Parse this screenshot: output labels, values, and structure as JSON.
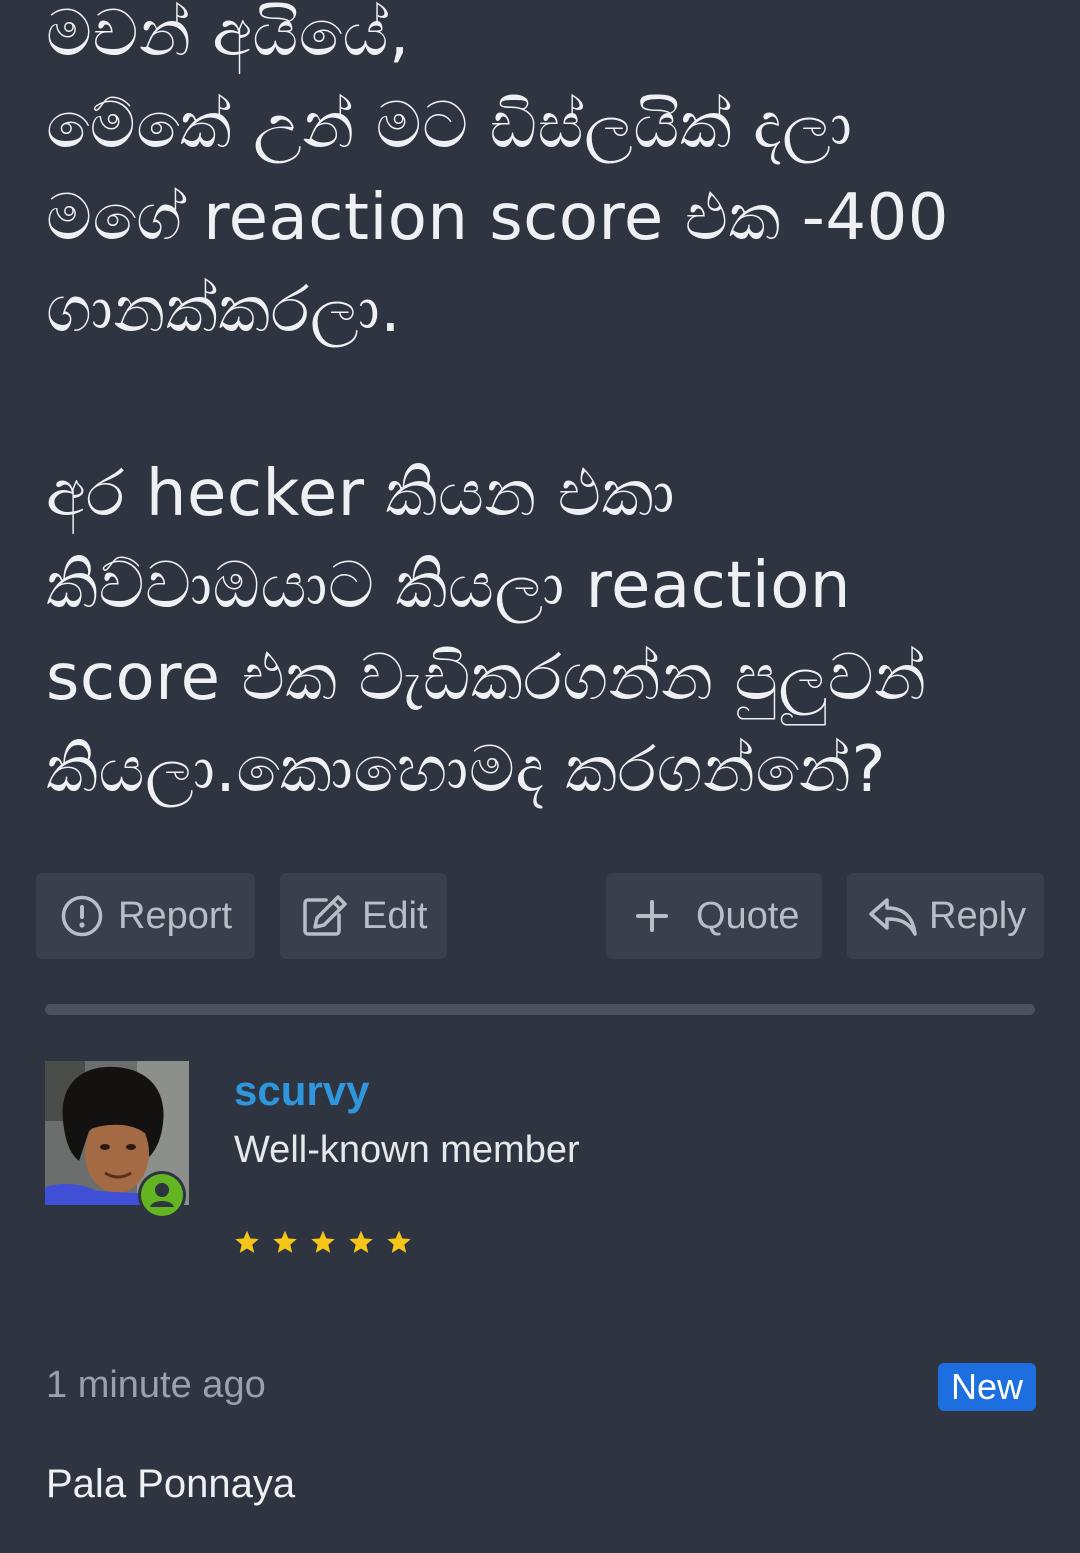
{
  "post": {
    "lines": [
      "මචන් අයියේ,",
      "මේකේ උන් මට ඩිස්ලයික් දලා",
      "මගේ reaction score එක -400",
      "ගානක්කරලා.",
      "අර hecker කියන එකා",
      "කිව්වාඔයාට කියලා reaction",
      "score එක වැඩිකරගන්න පුලුවන්",
      "කියලා.කොහොමද කරගන්නේ?"
    ]
  },
  "actions": {
    "report": "Report",
    "edit": "Edit",
    "quote": "Quote",
    "reply": "Reply"
  },
  "next_post": {
    "username": "scurvy",
    "user_title": "Well-known member",
    "star_count": 5,
    "time": "1 minute ago",
    "badge": "New",
    "body": "Pala Ponnaya"
  },
  "icons": {
    "report": "exclamation-circle-icon",
    "edit": "edit-icon",
    "quote": "plus-icon",
    "reply": "reply-icon",
    "online": "user-online-icon",
    "star": "star-icon"
  },
  "colors": {
    "background": "#2e3440",
    "button": "#3a404b",
    "username": "#2f96dd",
    "online": "#63b521",
    "star": "#f5c518",
    "badge": "#1d6fe0"
  }
}
